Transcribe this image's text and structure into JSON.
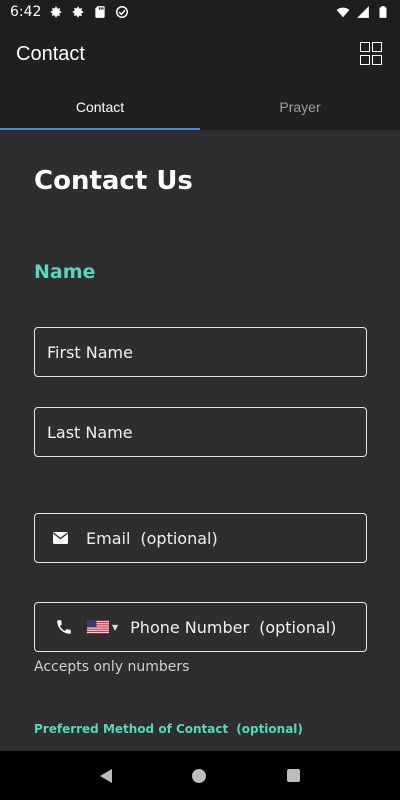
{
  "status_bar": {
    "time": "6:42",
    "left_icons": [
      "gear-icon",
      "gear-icon",
      "sd-card-icon",
      "data-saver-icon"
    ],
    "right_icons": [
      "wifi-icon",
      "signal-icon",
      "battery-icon"
    ]
  },
  "app_bar": {
    "title": "Contact",
    "menu_icon": "grid-icon"
  },
  "tabs": [
    {
      "label": "Contact",
      "active": true
    },
    {
      "label": "Prayer",
      "active": false
    }
  ],
  "form": {
    "title": "Contact Us",
    "name_section": "Name",
    "first_name_placeholder": "First Name",
    "last_name_placeholder": "Last Name",
    "email_placeholder": "Email",
    "email_optional": "(optional)",
    "phone_placeholder": "Phone Number",
    "phone_optional": "(optional)",
    "phone_country": "US",
    "phone_helper": "Accepts only numbers",
    "preferred_label": "Preferred Method of Contact",
    "preferred_optional": "(optional)"
  },
  "colors": {
    "accent_teal": "#55d6be",
    "tab_indicator": "#3d8ef0",
    "background": "#2e2e2e",
    "app_bar": "#202020"
  },
  "nav_bar": {
    "buttons": [
      "back-icon",
      "home-icon",
      "recents-icon"
    ]
  }
}
